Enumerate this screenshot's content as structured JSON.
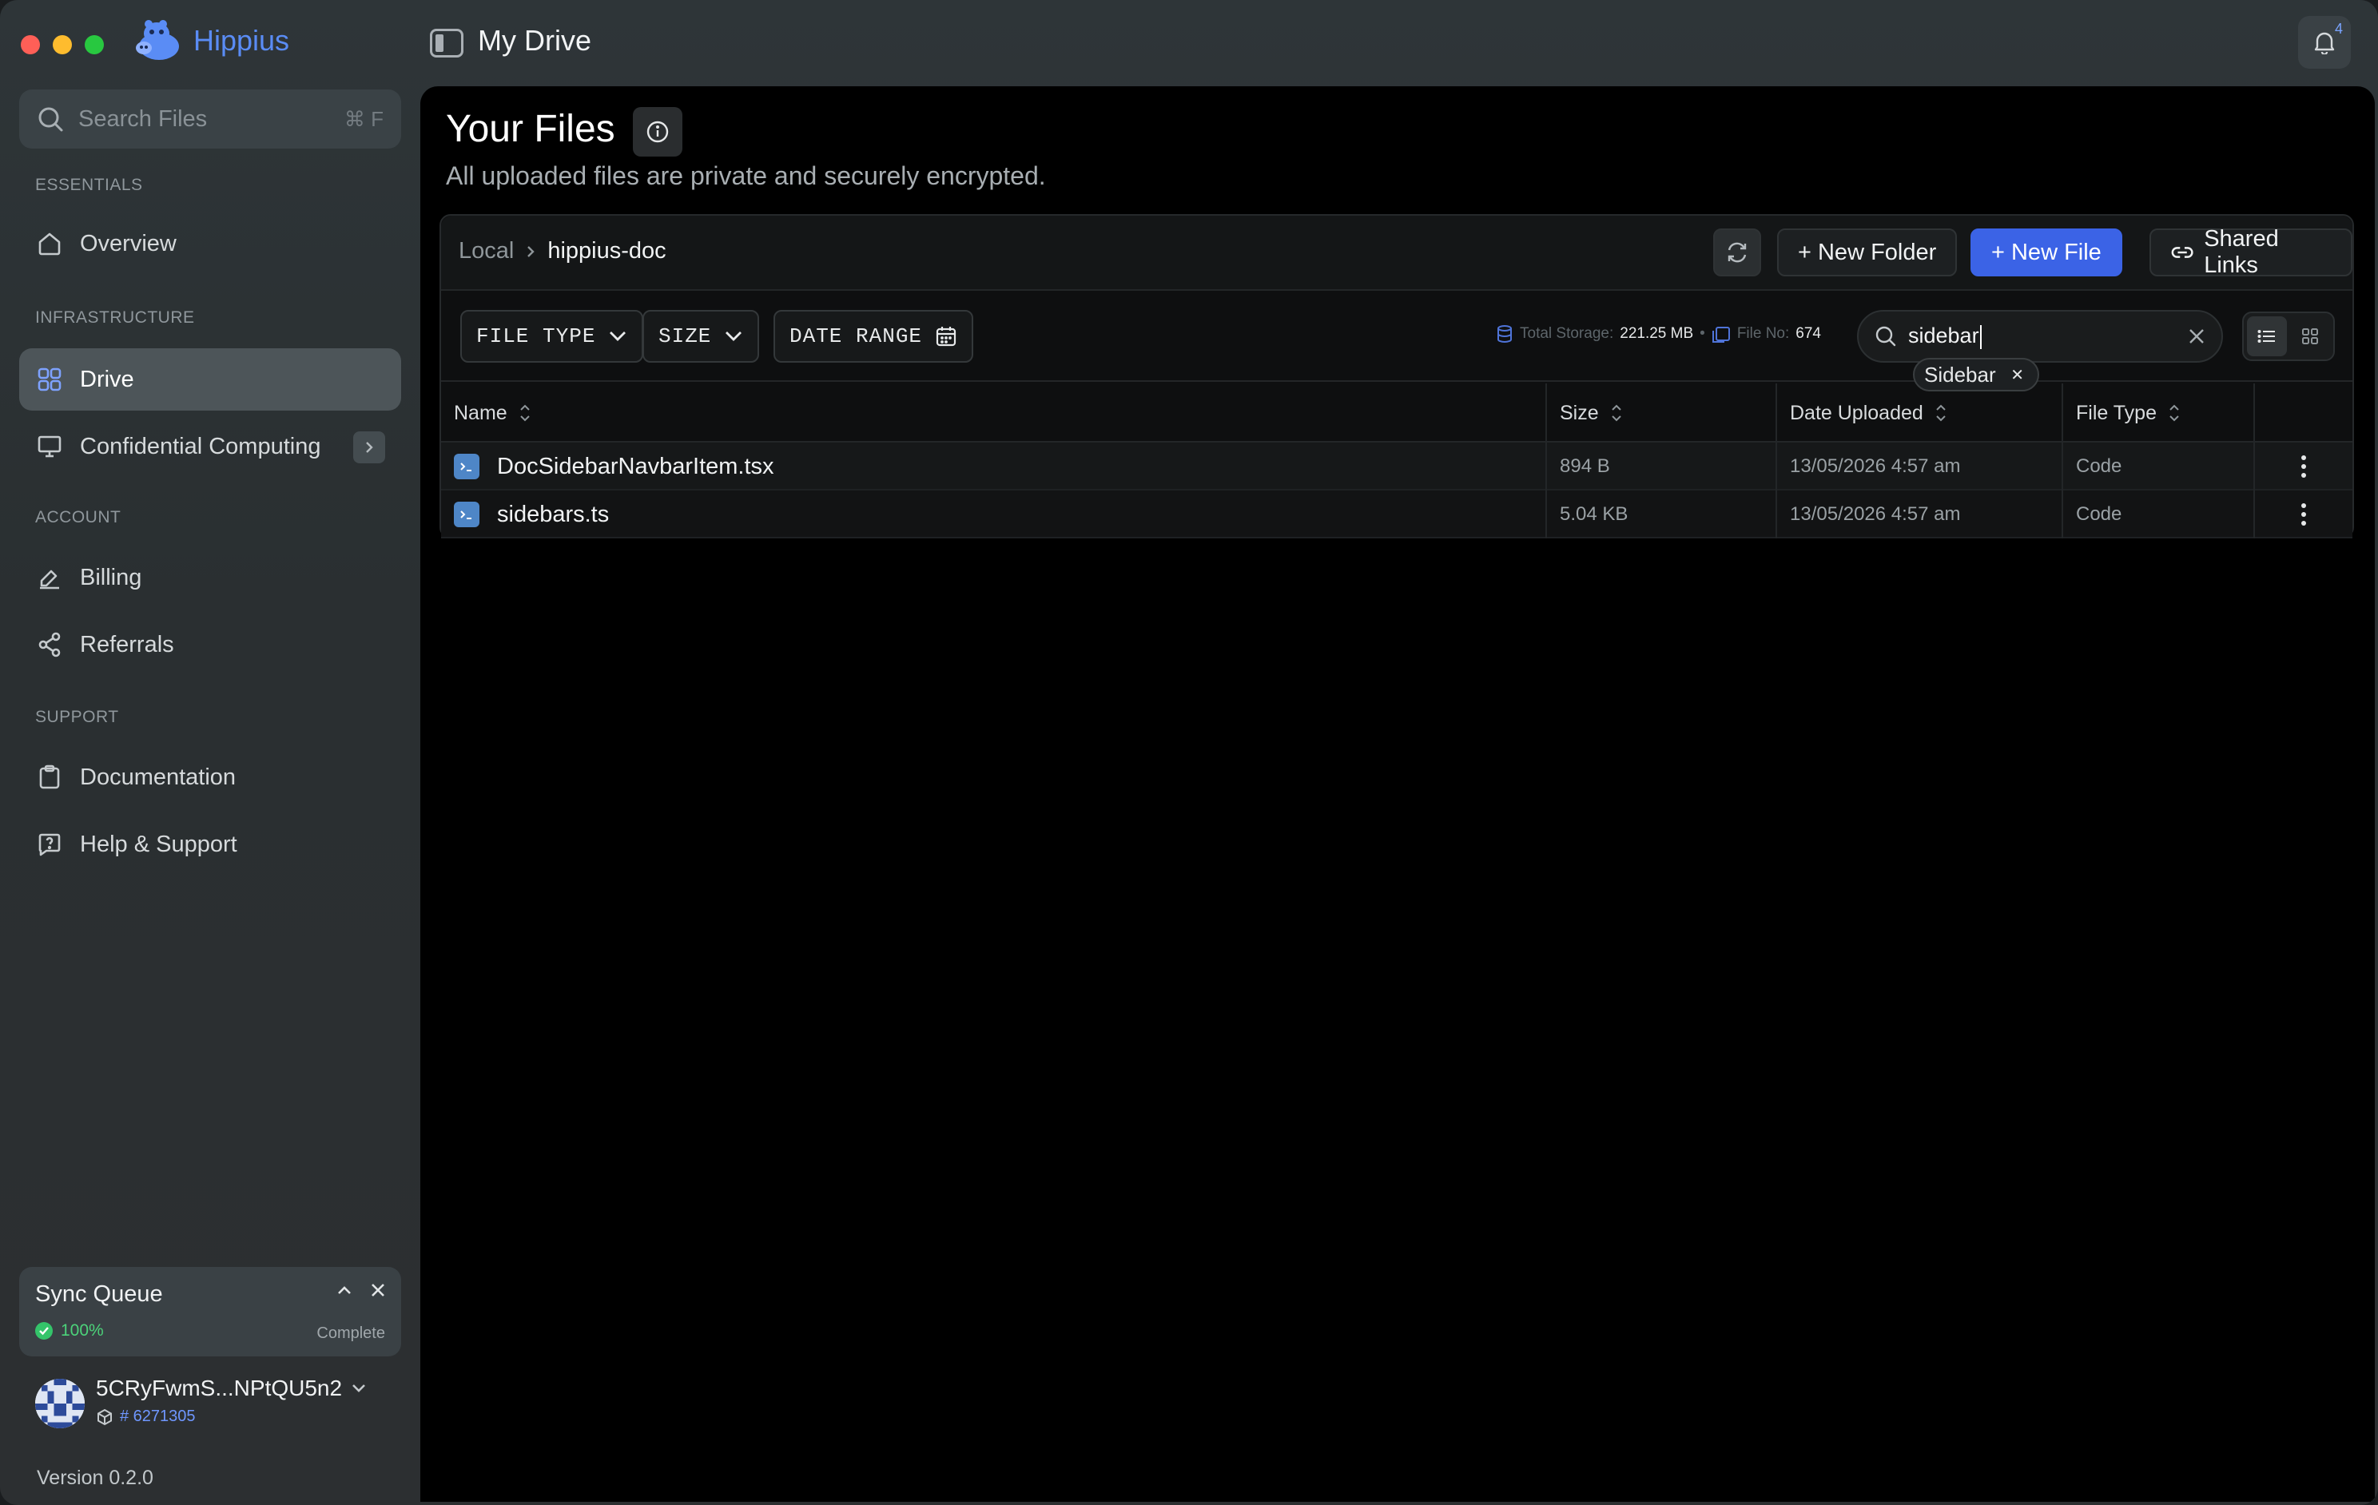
{
  "app": {
    "name": "Hippius",
    "page_heading": "My Drive",
    "notification_count": "4"
  },
  "sidebar": {
    "search": {
      "placeholder": "Search Files",
      "shortcut": "⌘ F"
    },
    "sections": {
      "essentials": "ESSENTIALS",
      "infrastructure": "INFRASTRUCTURE",
      "account": "ACCOUNT",
      "support": "SUPPORT"
    },
    "items": {
      "overview": "Overview",
      "drive": "Drive",
      "confidential": "Confidential Computing",
      "billing": "Billing",
      "referrals": "Referrals",
      "documentation": "Documentation",
      "help": "Help & Support"
    },
    "sync": {
      "title": "Sync Queue",
      "percent": "100%",
      "status": "Complete"
    },
    "account": {
      "name": "5CRyFwmS...NPtQU5n2",
      "id": "# 6271305"
    },
    "version": "Version 0.2.0"
  },
  "main": {
    "title": "Your Files",
    "subtitle": "All uploaded files are private and securely encrypted.",
    "breadcrumb": {
      "root": "Local",
      "current": "hippius-doc"
    },
    "buttons": {
      "new_folder": "+ New Folder",
      "new_file": "+ New File",
      "shared_links": "Shared Links"
    },
    "filters": {
      "file_type": "FILE TYPE",
      "size": "SIZE",
      "date_range": "DATE RANGE"
    },
    "stats": {
      "storage_label": "Total Storage:",
      "storage_value": "221.25 MB",
      "separator": "•",
      "files_label": "File No:",
      "files_value": "674"
    },
    "search": {
      "query": "sidebar",
      "suggestion": "Sidebar"
    },
    "table": {
      "headers": {
        "name": "Name",
        "size": "Size",
        "date": "Date Uploaded",
        "type": "File Type"
      },
      "rows": [
        {
          "name": "DocSidebarNavbarItem.tsx",
          "size": "894 B",
          "date": "13/05/2026 4:57 am",
          "type": "Code"
        },
        {
          "name": "sidebars.ts",
          "size": "5.04 KB",
          "date": "13/05/2026 4:57 am",
          "type": "Code"
        }
      ]
    }
  },
  "colors": {
    "accent": "#3b63e6",
    "brand": "#5a8cf5",
    "success": "#34c46a"
  }
}
